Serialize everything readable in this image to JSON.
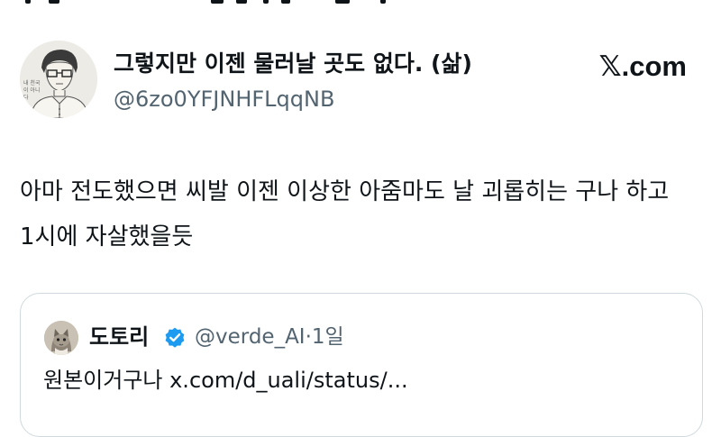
{
  "tweet": {
    "author": {
      "display_name": "그렇지만 이젠 물러날 곳도 없다. (삶)",
      "handle": "@6zo0YFJNHFLqqNB",
      "avatar_caption": "내 천국이 아니다"
    },
    "brand": "𝕏.com",
    "text": "아마 전도했으면 씨발 이젠 이상한 아줌마도 날 괴롭히는 구나 하고 1시에 자살했을듯"
  },
  "quote": {
    "author": {
      "display_name": "도토리",
      "handle": "@verde_AI",
      "separator": "·",
      "time": "1일"
    },
    "text": "원본이거구나 x.com/d_uali/status/..."
  },
  "icons": {
    "verified": "verified-badge-icon",
    "quote_avatar": "cat-avatar-icon"
  },
  "colors": {
    "text": "#0f1419",
    "secondary": "#536471",
    "border": "#cfd9de",
    "verified": "#1d9bf0"
  }
}
